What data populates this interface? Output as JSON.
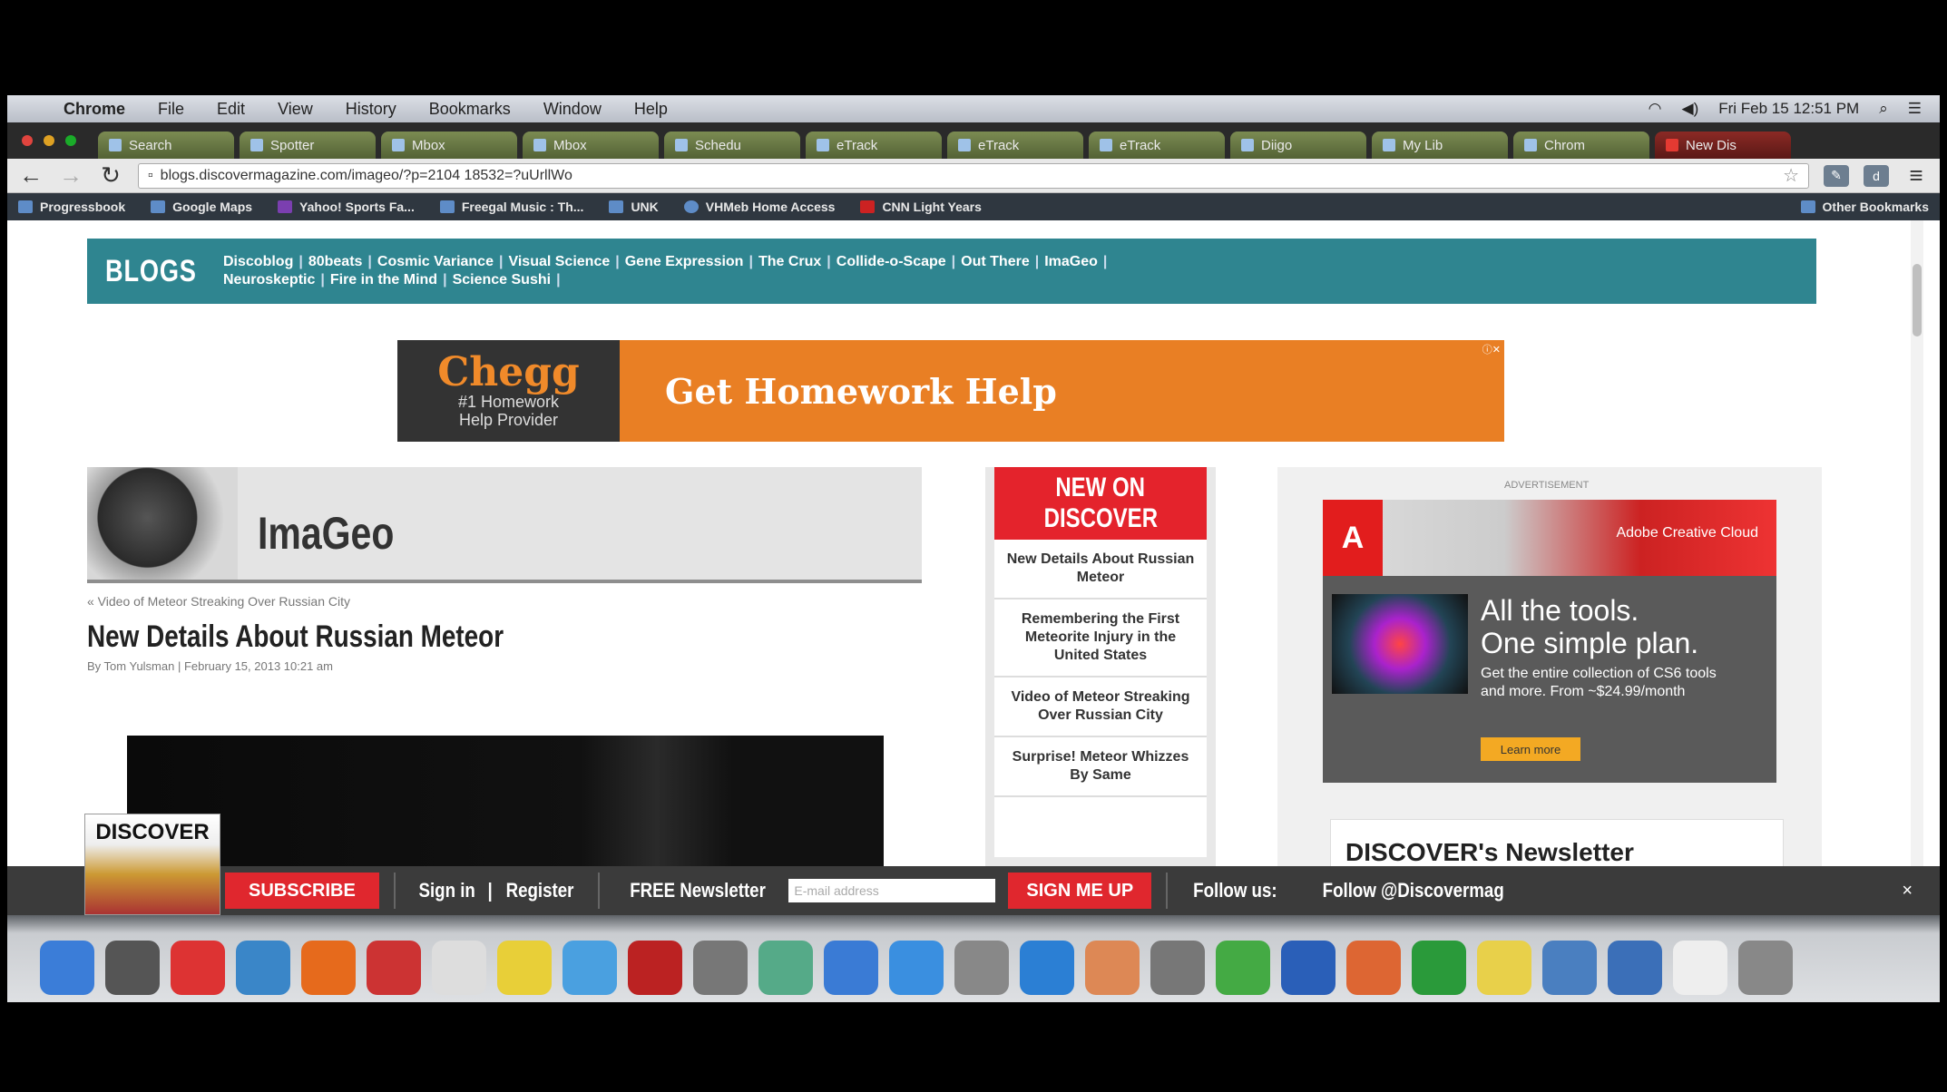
{
  "menubar": {
    "app": "Chrome",
    "items": [
      "File",
      "Edit",
      "View",
      "History",
      "Bookmarks",
      "Window",
      "Help"
    ],
    "clock": "Fri Feb 15  12:51 PM"
  },
  "tabs": [
    "Search",
    "Spotter",
    "Mbox",
    "Mbox",
    "Schedu",
    "eTrack",
    "eTrack",
    "eTrack",
    "Diigo",
    "My Lib",
    "Chrom",
    "New Dis"
  ],
  "toolbar": {
    "url": "blogs.discovermagazine.com/imageo/?p=2104 18532=?uUrllWo"
  },
  "bookmarks": [
    {
      "label": "Progressbook"
    },
    {
      "label": "Google Maps"
    },
    {
      "label": "Yahoo! Sports Fa..."
    },
    {
      "label": "Freegal Music : Th..."
    },
    {
      "label": "UNK"
    },
    {
      "label": "VHMeb Home Access"
    },
    {
      "label": "CNN Light Years"
    },
    {
      "label": "Other Bookmarks"
    }
  ],
  "blogs": {
    "label": "BLOGS",
    "row1": [
      "Discoblog",
      "80beats",
      "Cosmic Variance",
      "Visual Science",
      "Gene Expression",
      "The Crux",
      "Collide-o-Scape",
      "Out There",
      "ImaGeo"
    ],
    "row2": [
      "Neuroskeptic",
      "Fire in the Mind",
      "Science Sushi"
    ]
  },
  "chegg": {
    "brand": "Chegg",
    "tagline1": "#1 Homework",
    "tagline2": "Help Provider",
    "cta": "Get Homework Help"
  },
  "imageo": {
    "title": "ImaGeo",
    "crumb": "« Video of Meteor Streaking Over Russian City",
    "headline": "New Details About Russian Meteor",
    "byline": "By Tom Yulsman | February 15, 2013 10:21 am"
  },
  "new_on_discover": {
    "title_line1": "NEW ON",
    "title_line2": "DISCOVER",
    "items": [
      "New Details About Russian Meteor",
      "Remembering the First Meteorite Injury in the United States",
      "Video of Meteor Streaking Over Russian City",
      "Surprise! Meteor Whizzes By Same"
    ]
  },
  "adobe_ad": {
    "advertisement": "ADVERTISEMENT",
    "logo": "A",
    "product": "Adobe Creative Cloud",
    "headline1": "All the tools.",
    "headline2": "One simple plan.",
    "body": "Get the entire collection of CS6 tools and more. From ~$24.99/month",
    "button": "Learn more"
  },
  "newsletter_box": "DISCOVER's Newsletter",
  "subscribe_bar": {
    "magazine": "DISCOVER",
    "subscribe": "SUBSCRIBE",
    "sign_in": "Sign in",
    "register": "Register",
    "newsletter": "FREE Newsletter",
    "email_placeholder": "E-mail address",
    "sign_me_up": "SIGN ME UP",
    "follow": "Follow us:",
    "twitter": "Follow @Discovermag",
    "close": "×"
  },
  "dock": [
    {
      "name": "finder",
      "color": "#3b7dd8"
    },
    {
      "name": "dashboard",
      "color": "#555"
    },
    {
      "name": "chrome",
      "color": "#d33"
    },
    {
      "name": "safari",
      "color": "#3a86c8"
    },
    {
      "name": "firefox",
      "color": "#e66a1c"
    },
    {
      "name": "calendar",
      "color": "#c33"
    },
    {
      "name": "notes",
      "color": "#ddd"
    },
    {
      "name": "stickies",
      "color": "#e8cf38"
    },
    {
      "name": "messages",
      "color": "#4aa0e0"
    },
    {
      "name": "acrobat",
      "color": "#b22"
    },
    {
      "name": "photo",
      "color": "#777"
    },
    {
      "name": "maps",
      "color": "#5a8"
    },
    {
      "name": "itunes",
      "color": "#3a7bd5"
    },
    {
      "name": "app-store",
      "color": "#3a8fe0"
    },
    {
      "name": "preview",
      "color": "#888"
    },
    {
      "name": "network",
      "color": "#2b7fd4"
    },
    {
      "name": "keynote",
      "color": "#d85"
    },
    {
      "name": "pen",
      "color": "#777"
    },
    {
      "name": "numbers",
      "color": "#4a4"
    },
    {
      "name": "word",
      "color": "#2a5fb8"
    },
    {
      "name": "powerpoint",
      "color": "#d63"
    },
    {
      "name": "excel",
      "color": "#2a9a3a"
    },
    {
      "name": "folder",
      "color": "#e8d04a"
    },
    {
      "name": "screen",
      "color": "#4a7fc0"
    },
    {
      "name": "gallery",
      "color": "#3b6fb8"
    },
    {
      "name": "document",
      "color": "#eee"
    },
    {
      "name": "trash",
      "color": "#888"
    }
  ],
  "colors": {
    "teal": "#2f8590",
    "chegg_orange": "#e97f24",
    "discover_red": "#e4232c"
  }
}
